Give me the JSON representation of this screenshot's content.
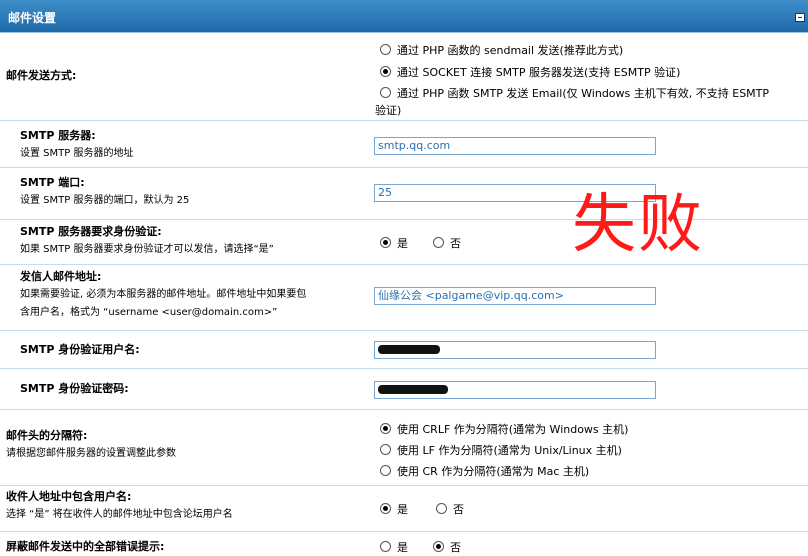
{
  "header": {
    "title": "邮件设置"
  },
  "send_method": {
    "label": "邮件发送方式:",
    "options": [
      {
        "label": "通过 PHP 函数的 sendmail 发送(推荐此方式)",
        "selected": false
      },
      {
        "label": "通过 SOCKET 连接 SMTP 服务器发送(支持 ESMTP 验证)",
        "selected": true
      },
      {
        "label": "通过 PHP 函数 SMTP 发送 Email(仅 Windows 主机下有效, 不支持 ESMTP",
        "selected": false
      }
    ],
    "option3_cont": "验证)"
  },
  "smtp_server": {
    "label": "SMTP 服务器:",
    "desc": "设置 SMTP 服务器的地址",
    "value": "smtp.qq.com"
  },
  "smtp_port": {
    "label": "SMTP 端口:",
    "desc": "设置 SMTP 服务器的端口，默认为 25",
    "value": "25"
  },
  "smtp_auth": {
    "label": "SMTP 服务器要求身份验证:",
    "desc": "如果 SMTP 服务器要求身份验证才可以发信，请选择“是”",
    "yes": "是",
    "no": "否",
    "selected": "yes"
  },
  "sender": {
    "label": "发信人邮件地址:",
    "desc1": "如果需要验证, 必须为本服务器的邮件地址。邮件地址中如果要包",
    "desc2": "含用户名，格式为 “username <user@domain.com>”",
    "value": "仙缘公会 <palgame@vip.qq.com>"
  },
  "auth_user": {
    "label": "SMTP 身份验证用户名:"
  },
  "auth_pass": {
    "label": "SMTP 身份验证密码:"
  },
  "separator": {
    "label": "邮件头的分隔符:",
    "desc": "请根据您邮件服务器的设置调整此参数",
    "options": [
      {
        "label": "使用 CRLF 作为分隔符(通常为 Windows 主机)",
        "selected": true
      },
      {
        "label": "使用 LF 作为分隔符(通常为 Unix/Linux 主机)",
        "selected": false
      },
      {
        "label": "使用 CR 作为分隔符(通常为 Mac 主机)",
        "selected": false
      }
    ]
  },
  "include_username": {
    "label": "收件人地址中包含用户名:",
    "desc": "选择 “是” 将在收件人的邮件地址中包含论坛用户名",
    "yes": "是",
    "no": "否",
    "selected": "yes"
  },
  "mask_errors": {
    "label": "屏蔽邮件发送中的全部错误提示:",
    "yes": "是",
    "no": "否",
    "selected": "no"
  },
  "overlay": {
    "text": "失败",
    "color": "#ff1a1a"
  }
}
